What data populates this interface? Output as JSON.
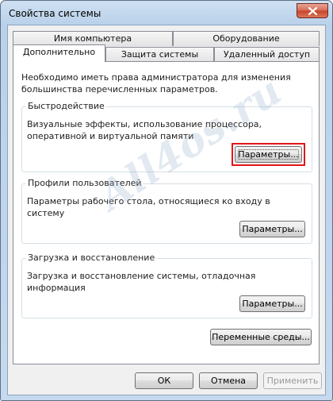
{
  "window": {
    "title": "Свойства системы"
  },
  "tabs": {
    "row1": [
      "Имя компьютера",
      "Оборудование"
    ],
    "row2": [
      "Дополнительно",
      "Защита системы",
      "Удаленный доступ"
    ],
    "active": "Дополнительно"
  },
  "panel": {
    "intro": "Необходимо иметь права администратора для изменения большинства перечисленных параметров.",
    "performance": {
      "title": "Быстродействие",
      "description": "Визуальные эффекты, использование процессора, оперативной и виртуальной памяти",
      "button": "Параметры..."
    },
    "profiles": {
      "title": "Профили пользователей",
      "description": "Параметры рабочего стола, относящиеся ко входу в систему",
      "button": "Параметры..."
    },
    "startup": {
      "title": "Загрузка и восстановление",
      "description": "Загрузка и восстановление системы, отладочная информация",
      "button": "Параметры..."
    },
    "env_button": "Переменные среды..."
  },
  "footer": {
    "ok": "ОК",
    "cancel": "Отмена",
    "apply": "Применить"
  },
  "watermark": "All4os.ru",
  "colors": {
    "highlight": "#e0161b",
    "titlebar": "#b9d1ea"
  }
}
